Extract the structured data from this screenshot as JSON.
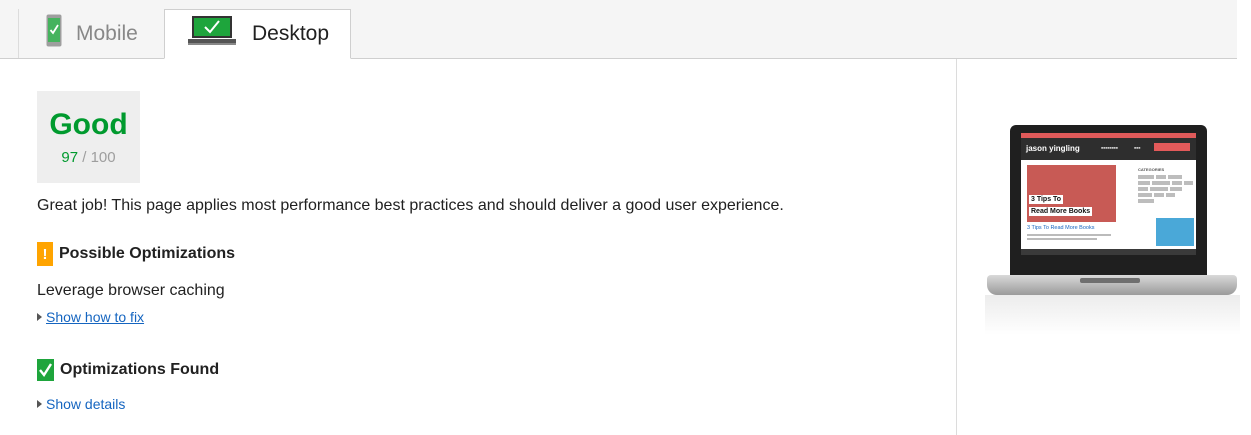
{
  "tabs": {
    "mobile_label": "Mobile",
    "desktop_label": "Desktop",
    "active": "Desktop"
  },
  "score": {
    "rating": "Good",
    "value": "97",
    "separator": "/",
    "max": "100"
  },
  "summary": "Great job! This page applies most performance best practices and should deliver a good user experience.",
  "possible": {
    "heading": "Possible Optimizations",
    "badge": "!",
    "rule": "Leverage browser caching",
    "link": "Show how to fix"
  },
  "found": {
    "heading": "Optimizations Found",
    "link": "Show details"
  },
  "preview": {
    "site_title": "jason yingling",
    "hero_line1": "3 Tips To",
    "hero_line2": "Read More Books",
    "post_title": "3 Tips To Read More Books",
    "categories_label": "CATEGORIES"
  },
  "colors": {
    "good": "#009a2e",
    "warning": "#ffa400",
    "success_badge": "#1ea53c",
    "link": "#1565c0"
  },
  "icons": {
    "mobile_tab": "phone-check-icon",
    "desktop_tab": "laptop-check-icon",
    "possible": "exclamation-icon",
    "found": "check-icon",
    "expand": "triangle-right-icon"
  }
}
